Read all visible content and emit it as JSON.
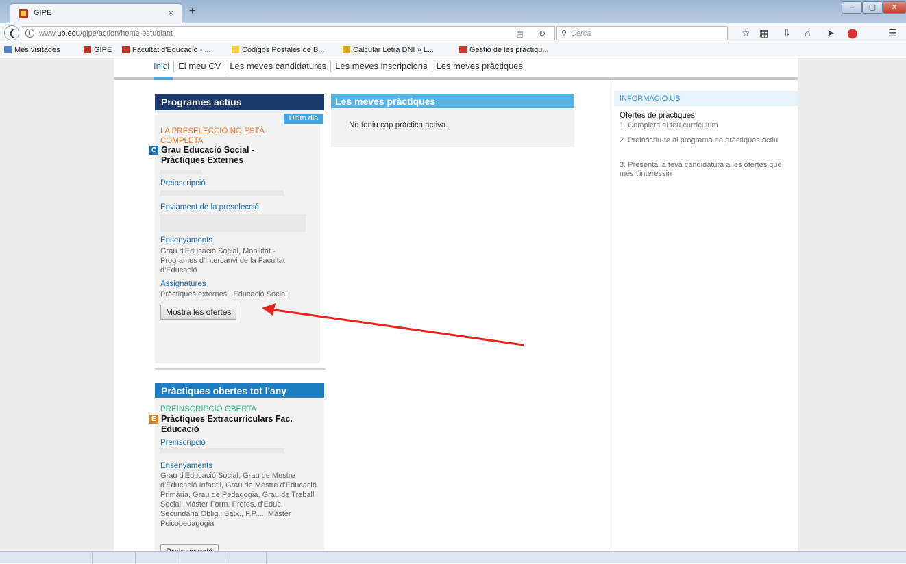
{
  "browser": {
    "tab_title": "GIPE",
    "tab_close": "×",
    "new_tab": "+",
    "url_prefix": "www.",
    "url_domain": "ub.edu",
    "url_path": "/gipe/action/home-estudiant",
    "search_placeholder": "Cerca",
    "win_min": "–",
    "win_max": "▢",
    "win_close": "✕"
  },
  "bookmarks": [
    {
      "label": "Més visitades",
      "icon": "bookmark-folder-icon",
      "color": "#5b82c2"
    },
    {
      "label": "GIPE",
      "icon": "ub-logo-icon",
      "color": "#b33a2b"
    },
    {
      "label": "Facultat d'Educació - ...",
      "icon": "ub-logo-icon",
      "color": "#b33a2b"
    },
    {
      "label": "Códigos Postales de B...",
      "icon": "mail-icon",
      "color": "#f0c94a"
    },
    {
      "label": "Calcular Letra DNI » L...",
      "icon": "dni-icon",
      "color": "#d9a52b"
    },
    {
      "label": "Gestió de les pràctiqu...",
      "icon": "ub-icon",
      "color": "#c73a3a"
    }
  ],
  "topnav": {
    "items": [
      "Inici",
      "El meu CV",
      "Les meves candidatures",
      "Les meves inscripcions",
      "Les meves pràctiques"
    ]
  },
  "programes_actius": {
    "header": "Programes actius",
    "badge": "Últim dia",
    "status": "LA PRESELECCIÓ NO ESTÀ COMPLETA",
    "letter": "C",
    "title": "Grau Educació Social - Pràctiques Externes",
    "preinscripcio_link": "Preinscripció",
    "enviament_link": "Enviament de la preselecció",
    "ensenyaments_label": "Ensenyaments",
    "ensenyaments_text": "Grau d'Educació Social, Mobilitat - Programes d'Intercanvi de la Facultat d'Educació",
    "assignatures_label": "Assignatures",
    "assignatures_text": "Pràctiques externes   Educació Social",
    "button": "Mostra les ofertes"
  },
  "meves_practiques": {
    "header": "Les meves pràctiques",
    "empty_text": "No teniu cap pràctica activa."
  },
  "info_ub": {
    "header": "INFORMACIÓ UB",
    "title": "Ofertes de pràctiques",
    "step1": "1. Completa el teu currículum",
    "step2": "2. Preinscriu-te al programa de pràctiques actiu",
    "step3": "3. Presenta la teva candidatura a les ofertes que més t'interessin"
  },
  "practiques_obertes": {
    "header": "Pràctiques obertes tot l'any",
    "status": "PREINSCRIPCIÓ OBERTA",
    "letter": "E",
    "title": "Pràctiques Extracurriculars Fac. Educació",
    "preinscripcio_link": "Preinscripció",
    "ensenyaments_label": "Ensenyaments",
    "ensenyaments_text": "Grau d'Educació Social, Grau de Mestre d'Educació Infantil, Grau de Mestre d'Educació Primària, Grau de Pedagogia, Grau de Treball Social, Màster Form. Profes. d'Educ. Secundària Oblig.i Batx., F.P...., Màster Psicopedagogia",
    "button": "Preinscripció"
  },
  "colors": {
    "annotation_arrow": "#e8231c",
    "dark_header": "#1b3a6b",
    "blue_header": "#5ab4e3",
    "link": "#1c6fb5",
    "warning": "#e8772a",
    "open": "#2eb87a"
  }
}
